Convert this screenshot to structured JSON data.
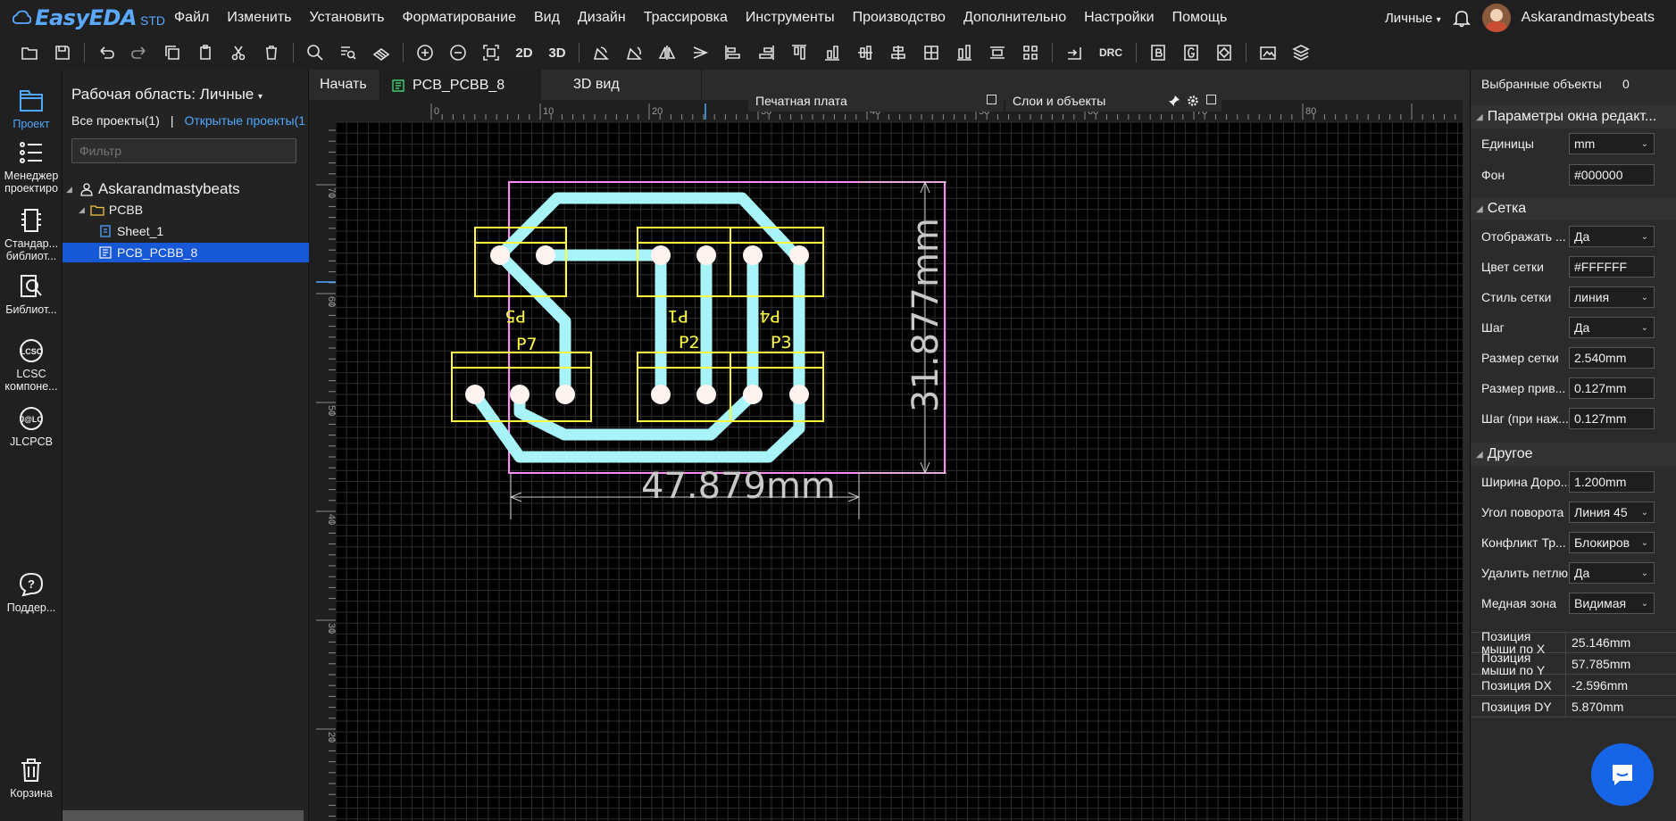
{
  "app": {
    "logo": "EasyEDA",
    "edition": "STD"
  },
  "menu": [
    "Файл",
    "Изменить",
    "Установить",
    "Форматирование",
    "Вид",
    "Дизайн",
    "Трассировка",
    "Инструменты",
    "Производство",
    "Дополнительно",
    "Настройки",
    "Помощь"
  ],
  "user": {
    "workspace": "Личные",
    "name": "Askarandmastybeats"
  },
  "toolbar": {
    "btn_2d": "2D",
    "btn_3d": "3D",
    "btn_drc": "DRC"
  },
  "nav": {
    "project": "Проект",
    "manager": "Менеджер проектиро",
    "standard": "Стандар... библиот...",
    "libraries": "Библиот...",
    "lcsc": "LCSC компоне...",
    "jlcpcb": "JLCPCB",
    "support": "Поддер...",
    "trash": "Корзина"
  },
  "project_panel": {
    "workspace_title": "Рабочая область: Личные",
    "all_projects": "Все проекты(1)",
    "separator": "|",
    "open_projects": "Открытые проекты(1)",
    "filter_placeholder": "Фильтр",
    "tree": {
      "user": "Askarandmastybeats",
      "project": "PCBB",
      "sheet": "Sheet_1",
      "pcb": "PCB_PCBB_8"
    }
  },
  "tabs": {
    "start": "Начать",
    "pcb": "PCB_PCBB_8",
    "view3d": "3D вид"
  },
  "canvas": {
    "panel_board": "Печатная плата",
    "panel_layers": "Слои и объекты",
    "ruler_top": [
      "0",
      "10",
      "20",
      "30",
      "40",
      "50",
      "60",
      "70",
      "80"
    ],
    "ruler_left": [
      "70",
      "60",
      "50",
      "40",
      "30",
      "20"
    ],
    "dim_width": "47.879mm",
    "dim_height": "31.877mm",
    "designators": {
      "p5": "P5",
      "p1": "P1",
      "p4": "P4",
      "p7": "P7",
      "p2": "P2",
      "p3": "P3"
    },
    "colors": {
      "background": "#000000",
      "grid": "#FFFFFF",
      "track": "#a7f3f7",
      "silk": "#ffff3f",
      "outline": "#ff8cf0",
      "dimension": "#c8c8c8"
    }
  },
  "right_panel": {
    "selected_label": "Выбранные объекты",
    "selected_count": "0",
    "section_editor": "Параметры окна редакт...",
    "units_label": "Единицы",
    "units_value": "mm",
    "bg_label": "Фон",
    "bg_value": "#000000",
    "section_grid": "Сетка",
    "show_label": "Отображать ...",
    "show_value": "Да",
    "grid_color_label": "Цвет сетки",
    "grid_color_value": "#FFFFFF",
    "grid_style_label": "Стиль сетки",
    "grid_style_value": "линия",
    "step_label": "Шаг",
    "step_value": "Да",
    "grid_size_label": "Размер сетки",
    "grid_size_value": "2.540mm",
    "snap_size_label": "Размер прив...",
    "snap_size_value": "0.127mm",
    "alt_step_label": "Шаг (при наж...",
    "alt_step_value": "0.127mm",
    "section_other": "Другое",
    "track_width_label": "Ширина Доро...",
    "track_width_value": "1.200mm",
    "angle_label": "Угол поворота",
    "angle_value": "Линия 45",
    "conflict_label": "Конфликт Тр...",
    "conflict_value": "Блокиров",
    "loop_label": "Удалить петлю",
    "loop_value": "Да",
    "copper_label": "Медная зона",
    "copper_value": "Видимая",
    "pos_x_label": "Позиция мыши по X",
    "pos_x_value": "25.146mm",
    "pos_y_label": "Позиция мыши по Y",
    "pos_y_value": "57.785mm",
    "dx_label": "Позиция DX",
    "dx_value": "-2.596mm",
    "dy_label": "Позиция DY",
    "dy_value": "5.870mm"
  }
}
